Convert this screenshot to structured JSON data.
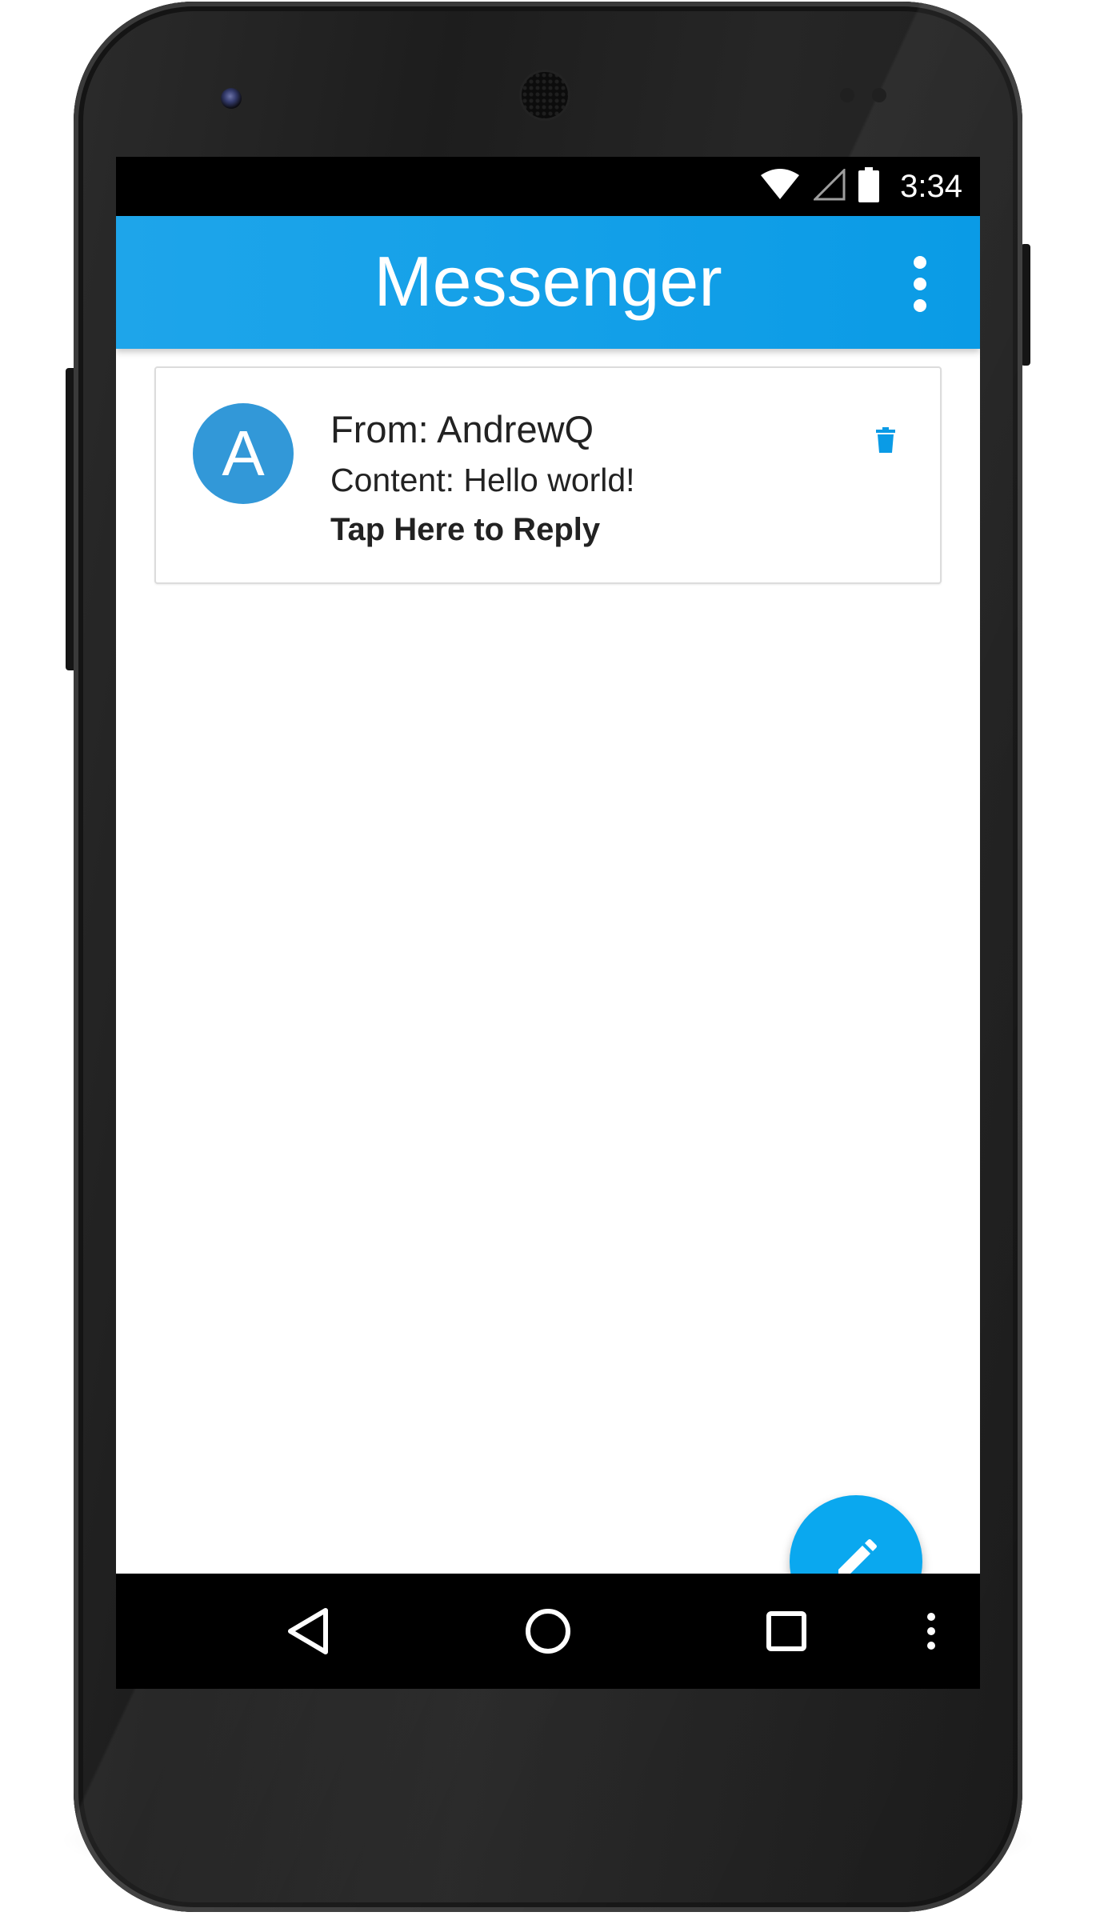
{
  "status_bar": {
    "time": "3:34",
    "icons": [
      "wifi-icon",
      "cellular-signal-icon",
      "battery-icon"
    ]
  },
  "app_bar": {
    "title": "Messenger",
    "overflow_icon": "more-vert-icon"
  },
  "messages": [
    {
      "avatar_letter": "A",
      "from": "From: AndrewQ",
      "content": "Content: Hello world!",
      "action": "Tap Here to Reply",
      "delete_icon": "trash-icon"
    }
  ],
  "fab": {
    "icon": "pencil-icon"
  },
  "nav_bar": {
    "icons": [
      "back-icon",
      "home-icon",
      "recents-icon",
      "more-vert-icon"
    ]
  },
  "colors": {
    "app_bar": "#0a9be6",
    "avatar": "#3298d8",
    "fab": "#0aa8ef",
    "delete_icon": "#0a9be6"
  }
}
